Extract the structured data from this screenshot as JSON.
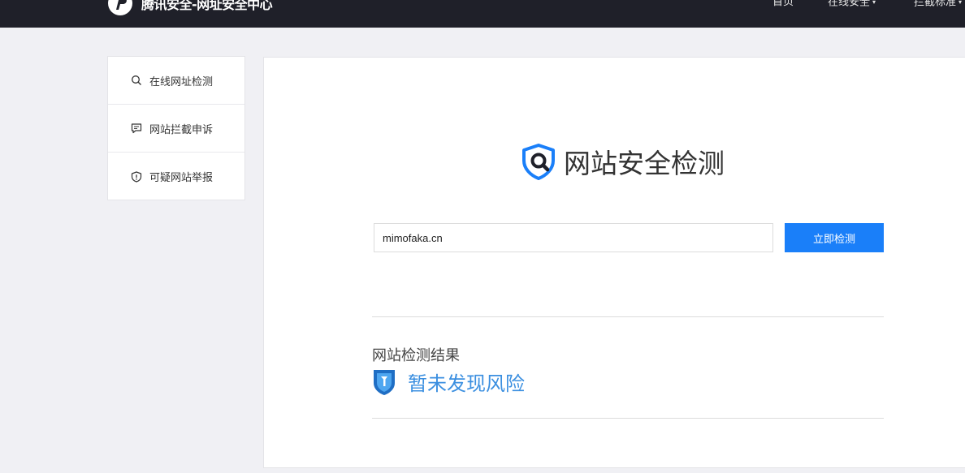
{
  "header": {
    "brand_title": "腾讯安全-网址安全中心",
    "nav": [
      {
        "label": "首页"
      },
      {
        "label": "在线安全",
        "caret": "▾"
      },
      {
        "label": "拦截标准",
        "caret": "▾"
      }
    ]
  },
  "sidebar": {
    "items": [
      {
        "label": "在线网址检测",
        "icon": "search-icon"
      },
      {
        "label": "网站拦截申诉",
        "icon": "chat-icon"
      },
      {
        "label": "可疑网站举报",
        "icon": "shield-alert-icon"
      }
    ]
  },
  "main": {
    "title": "网站安全检测",
    "search": {
      "value": "mimofaka.cn",
      "button_label": "立即检测"
    },
    "result": {
      "label": "网站检测结果",
      "status": "暂未发现风险"
    }
  },
  "colors": {
    "topbar": "#1f2029",
    "accent": "#1a7ff9",
    "safe": "#3b8fe0"
  }
}
